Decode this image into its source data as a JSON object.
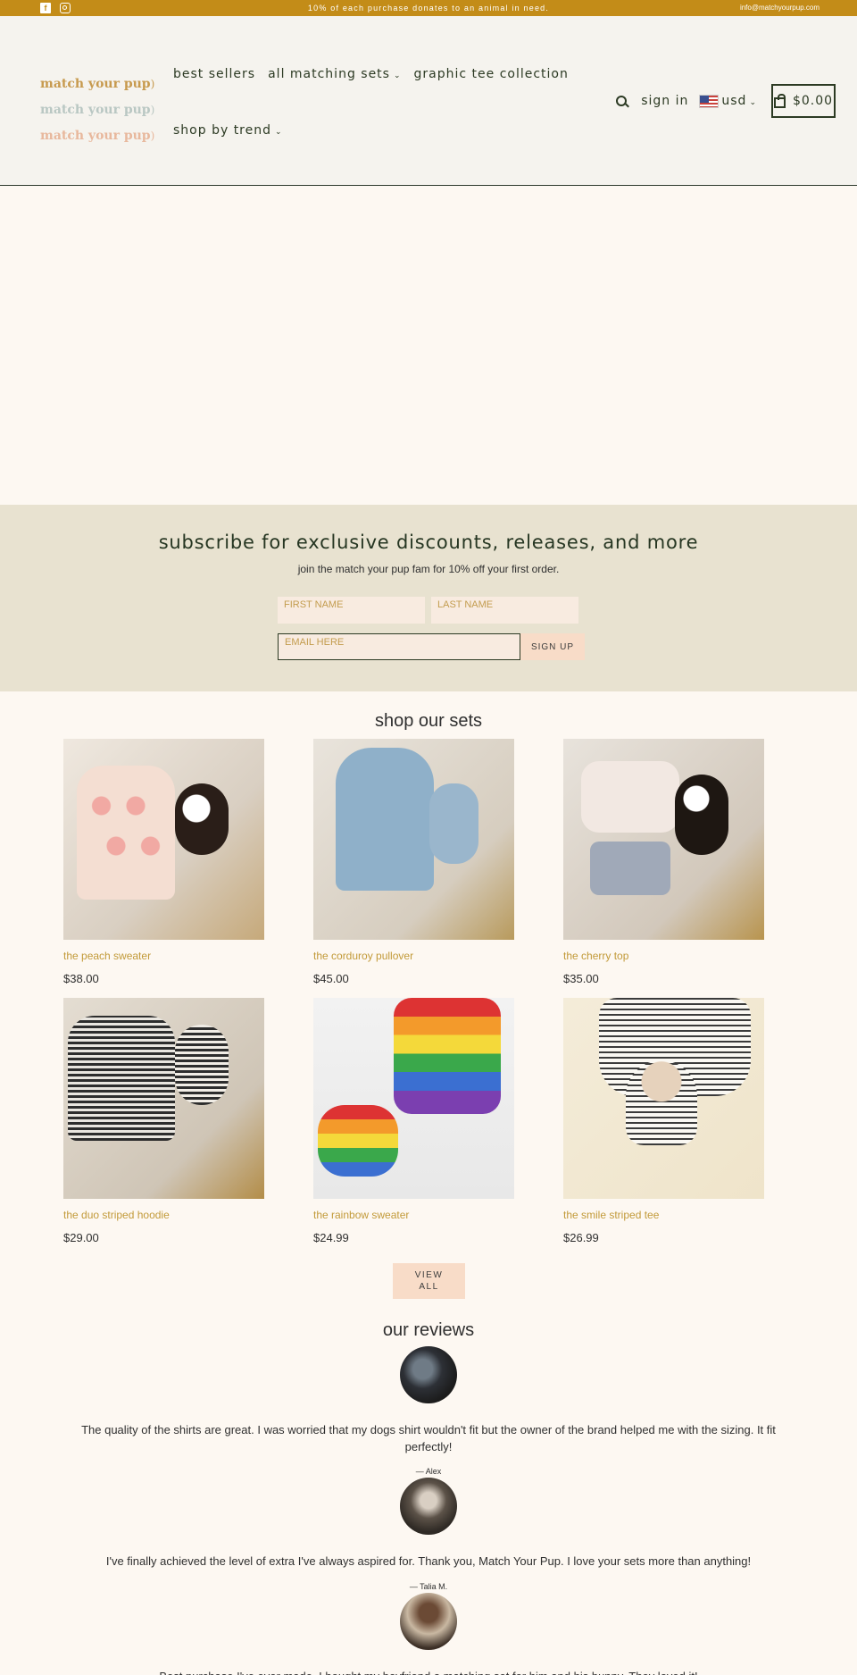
{
  "topbar": {
    "announcement": "10% of each purchase donates to an animal in need.",
    "email": "info@matchyourpup.com",
    "social": [
      "facebook-icon",
      "instagram-icon"
    ]
  },
  "header": {
    "logo_lines": [
      "match your pup",
      "match your pup",
      "match your pup"
    ],
    "nav": {
      "best_sellers": "best sellers",
      "all_matching_sets": "all matching sets",
      "graphic_tee": "graphic tee collection",
      "shop_by_trend": "shop by trend"
    },
    "sign_in": "sign in",
    "currency": "usd",
    "cart_total": "$0.00"
  },
  "subscribe": {
    "title": "subscribe for exclusive discounts, releases, and more",
    "subtitle": "join the match your pup fam for 10% off your first order.",
    "first_name_placeholder": "FIRST NAME",
    "last_name_placeholder": "LAST NAME",
    "email_placeholder": "EMAIL HERE",
    "button": "SIGN UP"
  },
  "products": {
    "title": "shop our sets",
    "items": [
      {
        "name": "the peach sweater",
        "price": "$38.00"
      },
      {
        "name": "the corduroy pullover",
        "price": "$45.00"
      },
      {
        "name": "the cherry top",
        "price": "$35.00"
      },
      {
        "name": "the duo striped hoodie",
        "price": "$29.00"
      },
      {
        "name": "the rainbow sweater",
        "price": "$24.99"
      },
      {
        "name": "the smile striped tee",
        "price": "$26.99"
      }
    ],
    "view_all": "VIEW ALL"
  },
  "reviews": {
    "title": "our reviews",
    "items": [
      {
        "text": "The quality of the shirts are great. I was worried that my dogs shirt wouldn't fit but the owner of the brand helped me with the sizing. It fit perfectly!",
        "author": "— Alex"
      },
      {
        "text": "I've finally achieved the level of extra I've always aspired for. Thank you, Match Your Pup. I love your sets more than anything!",
        "author": "— Talia M."
      },
      {
        "text": "Best purchase I've ever made. I bought my boyfriend a matching set for him and his bunny. They loved it!",
        "author": ""
      }
    ]
  },
  "colors": {
    "accent": "#c38c18",
    "header_bg": "#f5f3ee",
    "subscribe_bg": "#e8e2d0",
    "button_bg": "#f8dcc8",
    "product_name": "#c29a39"
  }
}
